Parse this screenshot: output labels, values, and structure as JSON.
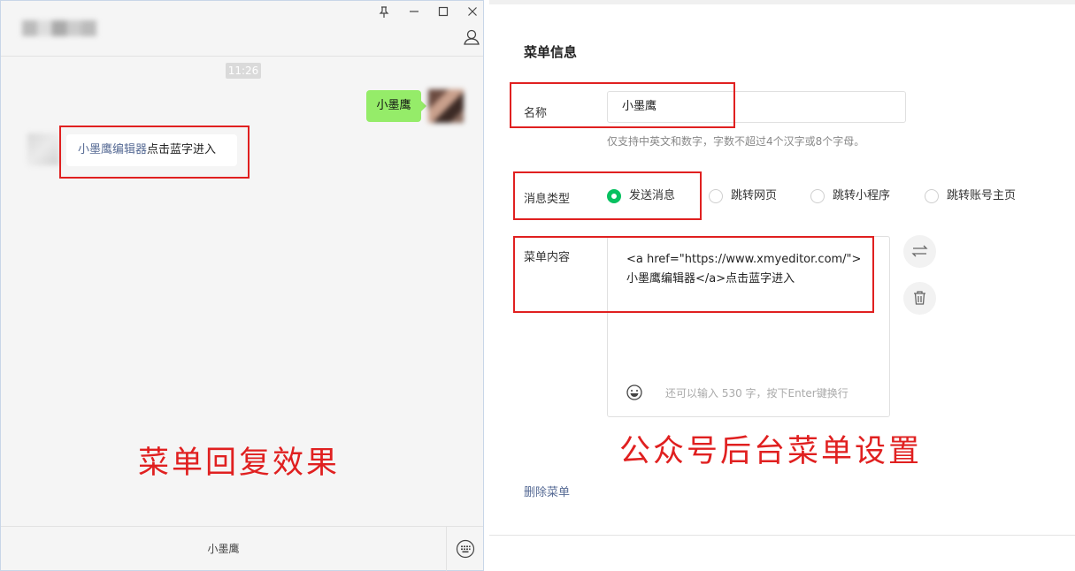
{
  "chat": {
    "time": "11:26",
    "sent_message": "小墨鹰",
    "received_link": "小墨鹰编辑器",
    "received_rest": "点击蓝字进入",
    "caption": "菜单回复效果",
    "footer_menu": "小墨鹰",
    "window_buttons": [
      "pin-icon",
      "minimize-icon",
      "maximize-icon",
      "close-icon"
    ]
  },
  "admin": {
    "section_title": "菜单信息",
    "name_label": "名称",
    "name_value": "小墨鹰",
    "name_hint": "仅支持中英文和数字，字数不超过4个汉字或8个字母。",
    "type_label": "消息类型",
    "type_options": [
      {
        "label": "发送消息",
        "checked": true
      },
      {
        "label": "跳转网页",
        "checked": false
      },
      {
        "label": "跳转小程序",
        "checked": false
      },
      {
        "label": "跳转账号主页",
        "checked": false
      }
    ],
    "content_label": "菜单内容",
    "content_value": "<a href=\"https://www.xmyeditor.com/\">\n小墨鹰编辑器</a>点击蓝字进入",
    "char_count": "还可以输入 530 字，按下Enter键换行",
    "caption": "公众号后台菜单设置",
    "delete_menu": "删除菜单"
  },
  "colors": {
    "accent_green": "#07c160",
    "bubble_green": "#95ec69",
    "annotation_red": "#e02020",
    "link_blue": "#576b95"
  }
}
